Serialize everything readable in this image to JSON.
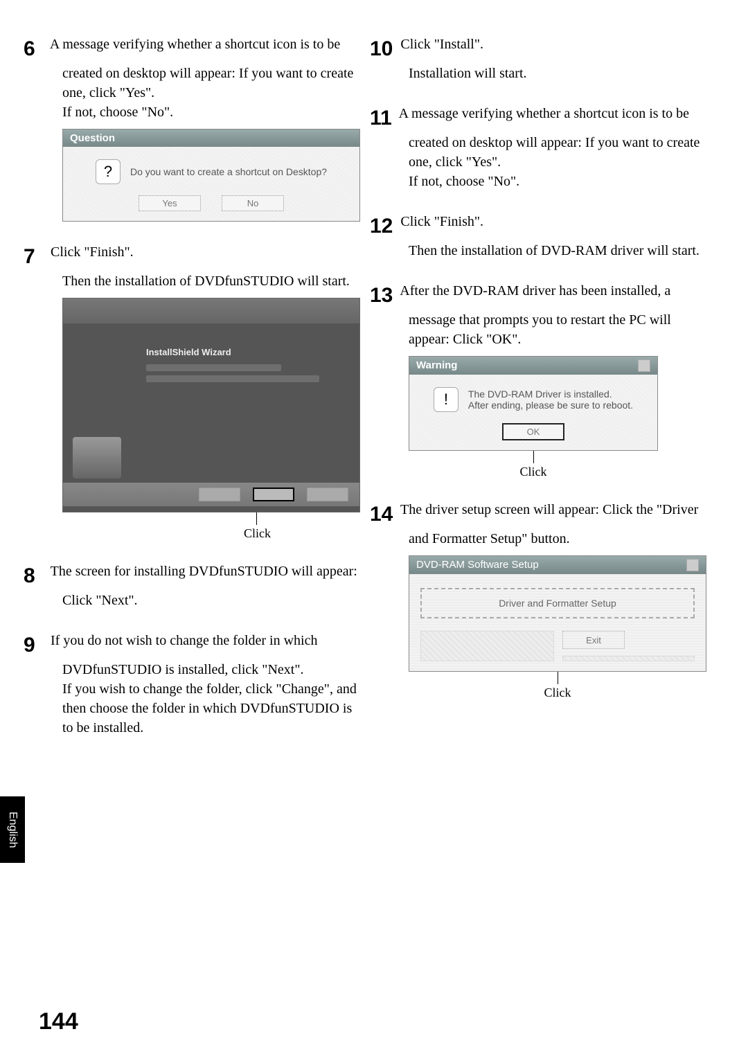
{
  "lang_tab": "English",
  "page_number": "144",
  "left": {
    "step6": {
      "num": "6",
      "text": "A message verifying whether a shortcut icon is to be created on desktop will appear: If you want to create one, click \"Yes\".\nIf not, choose \"No\"."
    },
    "dialog6": {
      "title": "Question",
      "message": "Do you want to create a shortcut on Desktop?",
      "yes": "Yes",
      "no": "No"
    },
    "step7": {
      "num": "7",
      "line1": "Click \"Finish\".",
      "line2": "Then the installation of DVDfunSTUDIO will start."
    },
    "installer7": {
      "heading": "InstallShield Wizard"
    },
    "click7": "Click",
    "step8": {
      "num": "8",
      "text": "The screen for installing DVDfunSTUDIO will appear: Click \"Next\"."
    },
    "step9": {
      "num": "9",
      "text": "If you do not wish to change the folder in which DVDfunSTUDIO is installed, click \"Next\".\nIf you wish to change the folder, click \"Change\", and then choose the folder in which DVDfunSTUDIO is to be installed."
    }
  },
  "right": {
    "step10": {
      "num": "10",
      "line1": "Click \"Install\".",
      "line2": "Installation will start."
    },
    "step11": {
      "num": "11",
      "text": "A message verifying whether a shortcut icon is to be created on desktop will appear: If you want to create one, click \"Yes\".\nIf not, choose \"No\"."
    },
    "step12": {
      "num": "12",
      "line1": "Click \"Finish\".",
      "line2": "Then the installation of DVD-RAM driver will start."
    },
    "step13": {
      "num": "13",
      "text": "After the DVD-RAM driver has been installed, a message that prompts you to restart the PC will appear: Click \"OK\"."
    },
    "dialog13": {
      "title": "Warning",
      "msg1": "The DVD-RAM Driver is installed.",
      "msg2": "After ending, please be sure to reboot.",
      "ok": "OK"
    },
    "click13": "Click",
    "step14": {
      "num": "14",
      "text": "The driver setup screen will appear: Click the \"Driver and Formatter Setup\" button."
    },
    "dialog14": {
      "title": "DVD-RAM Software Setup",
      "button": "Driver and Formatter Setup",
      "exit": "Exit"
    },
    "click14": "Click"
  }
}
